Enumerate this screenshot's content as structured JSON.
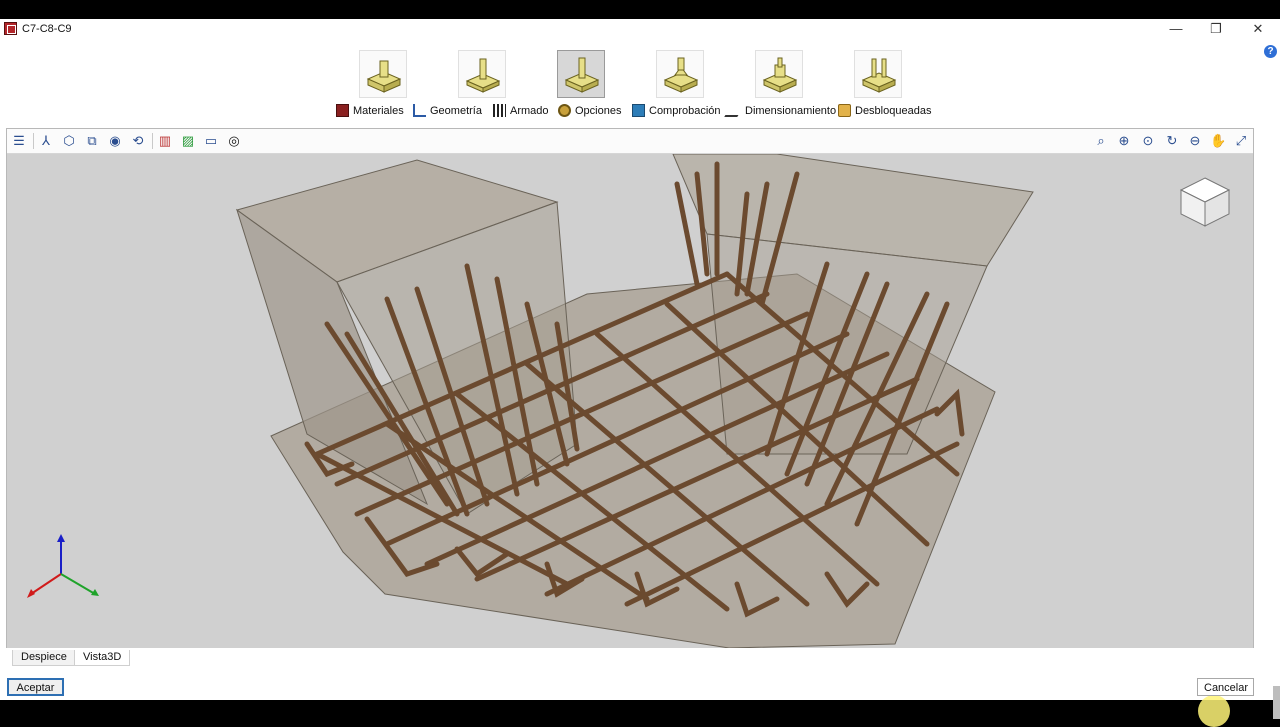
{
  "window": {
    "title": "C7-C8-C9",
    "minimize": "—",
    "maximize": "❐",
    "close": "✕",
    "help": "?"
  },
  "modules": [
    {
      "label": "Materiales",
      "icon": "brick-wall-icon",
      "active": false
    },
    {
      "label": "Geometría",
      "icon": "ruler-compass-icon",
      "active": false
    },
    {
      "label": "Armado",
      "icon": "rebar-grid-icon",
      "active": true
    },
    {
      "label": "Opciones",
      "icon": "gears-icon",
      "active": false
    },
    {
      "label": "Comprobación",
      "icon": "monitor-check-icon",
      "active": false
    },
    {
      "label": "Dimensionamiento",
      "icon": "pencil-icon",
      "active": false
    },
    {
      "label": "Desbloqueadas",
      "icon": "unlock-icon",
      "active": false
    }
  ],
  "view_tools_left": [
    "layers-icon",
    "axis-icon",
    "box-view-icon",
    "solid-view-icon",
    "eye-solid-icon",
    "rotate-axis-icon",
    "panels-icon",
    "green-grid-icon",
    "frame-icon",
    "visibility-icon"
  ],
  "view_tools_right": [
    "zoom-window-icon",
    "zoom-extents-icon",
    "zoom-in-icon",
    "refresh-view-icon",
    "zoom-out-icon",
    "pan-hand-icon",
    "fit-view-icon"
  ],
  "bottom_tabs": [
    {
      "label": "Despiece",
      "active": false
    },
    {
      "label": "Vista3D",
      "active": true
    }
  ],
  "buttons": {
    "accept": "Aceptar",
    "cancel": "Cancelar"
  },
  "colors": {
    "rebar": "#6b4a2f",
    "concrete": "#a89f92",
    "viewport_bg": "#d0d0d0",
    "accent": "#2d6fb3"
  }
}
